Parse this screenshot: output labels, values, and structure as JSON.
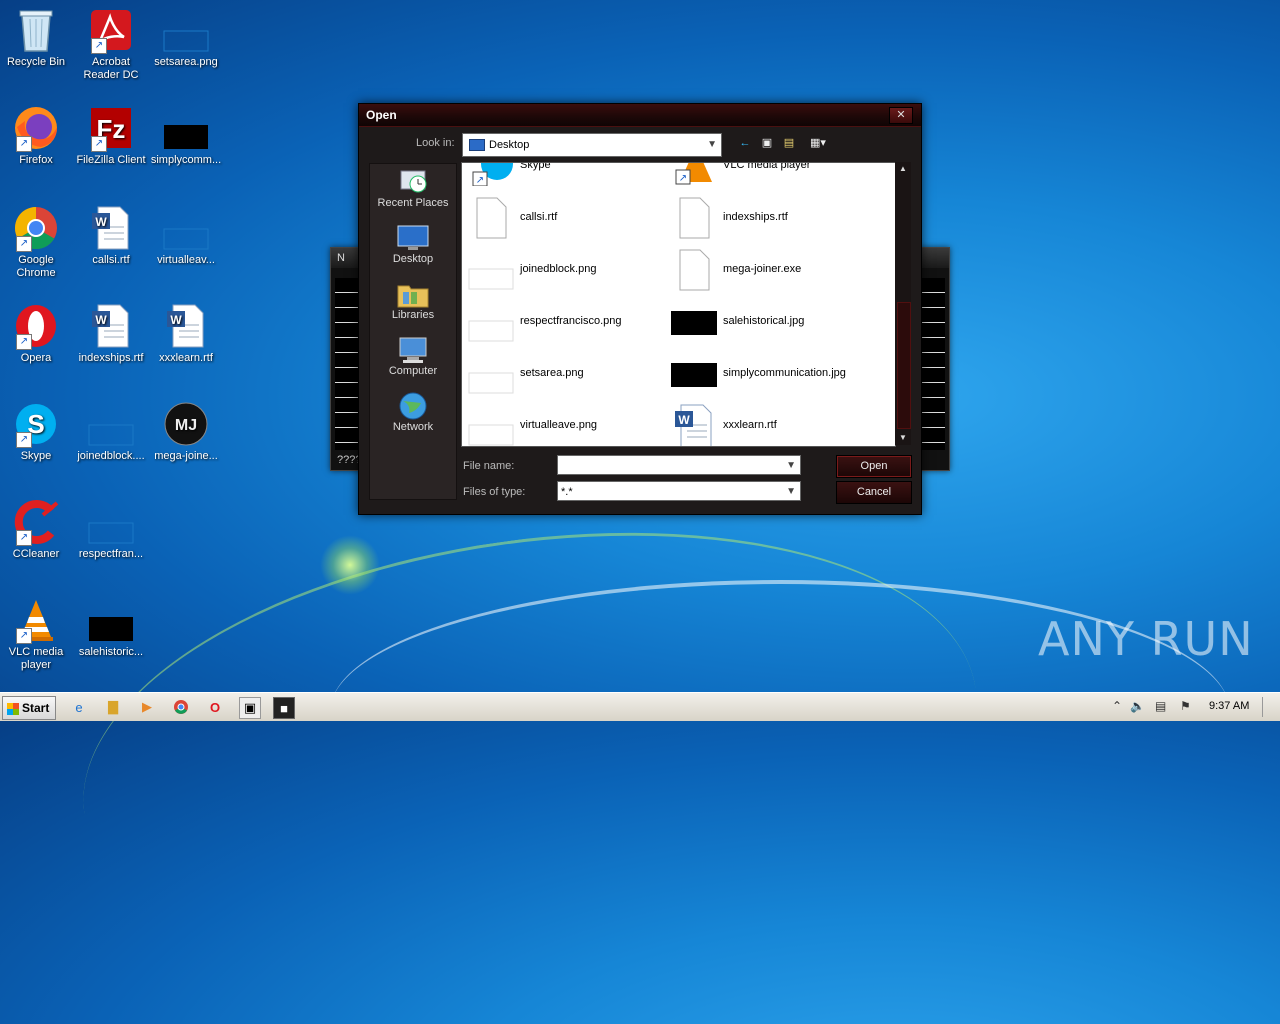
{
  "desktop_icons": [
    {
      "label": "Recycle Bin"
    },
    {
      "label": "Acrobat Reader DC"
    },
    {
      "label": "setsarea.png"
    },
    {
      "label": "Firefox"
    },
    {
      "label": "FileZilla Client"
    },
    {
      "label": "simplycomm..."
    },
    {
      "label": "Google Chrome"
    },
    {
      "label": "callsi.rtf"
    },
    {
      "label": "virtualleav..."
    },
    {
      "label": "Opera"
    },
    {
      "label": "indexships.rtf"
    },
    {
      "label": "xxxlearn.rtf"
    },
    {
      "label": "Skype"
    },
    {
      "label": "joinedblock...."
    },
    {
      "label": "mega-joine..."
    },
    {
      "label": "CCleaner"
    },
    {
      "label": "respectfran..."
    },
    {
      "label": "VLC media player"
    },
    {
      "label": "salehistoric..."
    }
  ],
  "background_window": {
    "title": "N",
    "footer": "????"
  },
  "dialog": {
    "title": "Open",
    "close": "✕",
    "look_in_label": "Look in:",
    "look_in_value": "Desktop",
    "places": [
      {
        "label": "Recent Places"
      },
      {
        "label": "Desktop"
      },
      {
        "label": "Libraries"
      },
      {
        "label": "Computer"
      },
      {
        "label": "Network"
      }
    ],
    "files": [
      {
        "name": "Skype"
      },
      {
        "name": "VLC media player"
      },
      {
        "name": "callsi.rtf"
      },
      {
        "name": "indexships.rtf"
      },
      {
        "name": "joinedblock.png"
      },
      {
        "name": "mega-joiner.exe"
      },
      {
        "name": "respectfrancisco.png"
      },
      {
        "name": "salehistorical.jpg"
      },
      {
        "name": "setsarea.png"
      },
      {
        "name": "simplycommunication.jpg"
      },
      {
        "name": "virtualleave.png"
      },
      {
        "name": "xxxlearn.rtf"
      }
    ],
    "file_name_label": "File name:",
    "file_name_value": "",
    "file_type_label": "Files of type:",
    "file_type_value": "*.*",
    "open_label": "Open",
    "cancel_label": "Cancel"
  },
  "taskbar": {
    "start_label": "Start",
    "clock": "9:37 AM"
  },
  "watermark": "ANY RUN"
}
